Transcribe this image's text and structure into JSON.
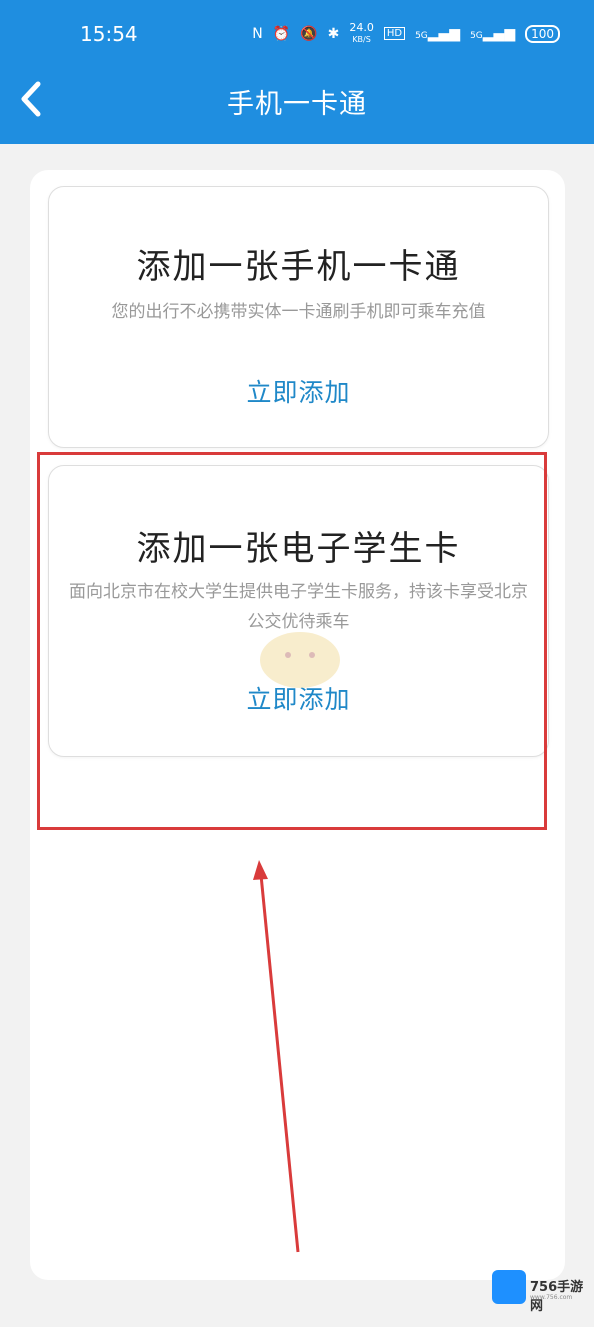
{
  "status_bar": {
    "time": "15:54",
    "icons": [
      "N",
      "alarm-icon",
      "mute-icon",
      "bluetooth-icon"
    ],
    "speed": "24.0",
    "speed_unit": "KB/S",
    "hd": "HD",
    "signal1": "5G",
    "signal2": "5G",
    "battery": "100"
  },
  "header": {
    "title": "手机一卡通",
    "back_icon": "chevron-left-icon",
    "color": "#1f8ee0"
  },
  "cards": [
    {
      "title": "添加一张手机一卡通",
      "description": "您的出行不必携带实体一卡通刷手机即可乘车充值",
      "action": "立即添加"
    },
    {
      "title": "添加一张电子学生卡",
      "description": "面向北京市在校大学生提供电子学生卡服务，持该卡享受北京公交优待乘车",
      "action": "立即添加"
    }
  ],
  "annotation": {
    "highlight_color": "#d93b3b"
  },
  "watermark": {
    "text": "756手游网",
    "sub": "www.756.com"
  }
}
